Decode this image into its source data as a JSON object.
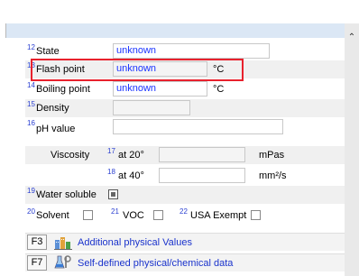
{
  "rows": {
    "state": {
      "num": "12",
      "label": "State",
      "value": "unknown"
    },
    "flash": {
      "num": "13",
      "label": "Flash point",
      "value": "unknown",
      "unit": "°C"
    },
    "boiling": {
      "num": "14",
      "label": "Boiling point",
      "value": "unknown",
      "unit": "°C"
    },
    "density": {
      "num": "15",
      "label": "Density",
      "value": ""
    },
    "ph": {
      "num": "16",
      "label": "pH value",
      "value": ""
    },
    "viscosity": {
      "label": "Viscosity",
      "v1": {
        "num": "17",
        "label": "at 20°",
        "value": "",
        "unit": "mPas"
      },
      "v2": {
        "num": "18",
        "label": "at 40°",
        "value": "",
        "unit": "mm²/s"
      }
    },
    "water": {
      "num": "19",
      "label": "Water soluble"
    },
    "checks": {
      "solvent": {
        "num": "20",
        "label": "Solvent"
      },
      "voc": {
        "num": "21",
        "label": "VOC"
      },
      "usa": {
        "num": "22",
        "label": "USA Exempt"
      }
    }
  },
  "footer": {
    "f3": {
      "key": "F3",
      "label": "Additional physical Values",
      "icon": "building-chart-icon"
    },
    "f7": {
      "key": "F7",
      "label": "Self-defined physical/chemical data",
      "icon": "flask-tools-icon"
    }
  },
  "colors": {
    "highlight": "#e8212d",
    "value_text": "#1a33ff",
    "link": "#1a33cc"
  }
}
